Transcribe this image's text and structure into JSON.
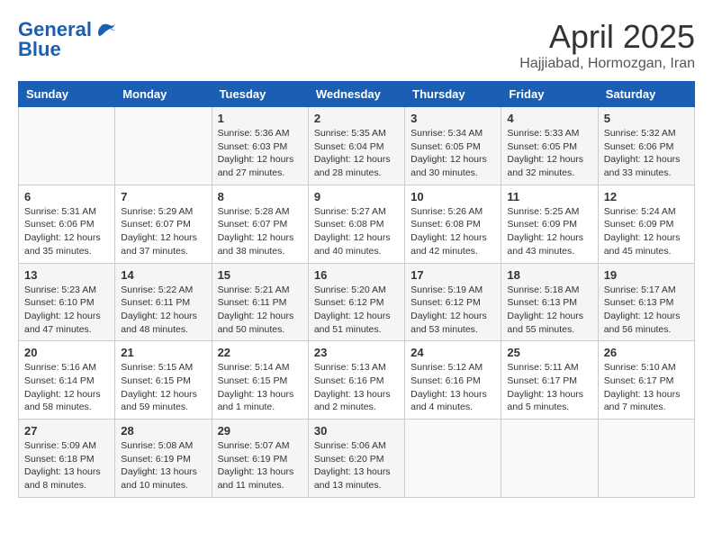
{
  "header": {
    "logo_general": "General",
    "logo_blue": "Blue",
    "title": "April 2025",
    "location": "Hajjiabad, Hormozgan, Iran"
  },
  "columns": [
    "Sunday",
    "Monday",
    "Tuesday",
    "Wednesday",
    "Thursday",
    "Friday",
    "Saturday"
  ],
  "weeks": [
    {
      "days": [
        {
          "num": "",
          "info": ""
        },
        {
          "num": "",
          "info": ""
        },
        {
          "num": "1",
          "info": "Sunrise: 5:36 AM\nSunset: 6:03 PM\nDaylight: 12 hours and 27 minutes."
        },
        {
          "num": "2",
          "info": "Sunrise: 5:35 AM\nSunset: 6:04 PM\nDaylight: 12 hours and 28 minutes."
        },
        {
          "num": "3",
          "info": "Sunrise: 5:34 AM\nSunset: 6:05 PM\nDaylight: 12 hours and 30 minutes."
        },
        {
          "num": "4",
          "info": "Sunrise: 5:33 AM\nSunset: 6:05 PM\nDaylight: 12 hours and 32 minutes."
        },
        {
          "num": "5",
          "info": "Sunrise: 5:32 AM\nSunset: 6:06 PM\nDaylight: 12 hours and 33 minutes."
        }
      ]
    },
    {
      "days": [
        {
          "num": "6",
          "info": "Sunrise: 5:31 AM\nSunset: 6:06 PM\nDaylight: 12 hours and 35 minutes."
        },
        {
          "num": "7",
          "info": "Sunrise: 5:29 AM\nSunset: 6:07 PM\nDaylight: 12 hours and 37 minutes."
        },
        {
          "num": "8",
          "info": "Sunrise: 5:28 AM\nSunset: 6:07 PM\nDaylight: 12 hours and 38 minutes."
        },
        {
          "num": "9",
          "info": "Sunrise: 5:27 AM\nSunset: 6:08 PM\nDaylight: 12 hours and 40 minutes."
        },
        {
          "num": "10",
          "info": "Sunrise: 5:26 AM\nSunset: 6:08 PM\nDaylight: 12 hours and 42 minutes."
        },
        {
          "num": "11",
          "info": "Sunrise: 5:25 AM\nSunset: 6:09 PM\nDaylight: 12 hours and 43 minutes."
        },
        {
          "num": "12",
          "info": "Sunrise: 5:24 AM\nSunset: 6:09 PM\nDaylight: 12 hours and 45 minutes."
        }
      ]
    },
    {
      "days": [
        {
          "num": "13",
          "info": "Sunrise: 5:23 AM\nSunset: 6:10 PM\nDaylight: 12 hours and 47 minutes."
        },
        {
          "num": "14",
          "info": "Sunrise: 5:22 AM\nSunset: 6:11 PM\nDaylight: 12 hours and 48 minutes."
        },
        {
          "num": "15",
          "info": "Sunrise: 5:21 AM\nSunset: 6:11 PM\nDaylight: 12 hours and 50 minutes."
        },
        {
          "num": "16",
          "info": "Sunrise: 5:20 AM\nSunset: 6:12 PM\nDaylight: 12 hours and 51 minutes."
        },
        {
          "num": "17",
          "info": "Sunrise: 5:19 AM\nSunset: 6:12 PM\nDaylight: 12 hours and 53 minutes."
        },
        {
          "num": "18",
          "info": "Sunrise: 5:18 AM\nSunset: 6:13 PM\nDaylight: 12 hours and 55 minutes."
        },
        {
          "num": "19",
          "info": "Sunrise: 5:17 AM\nSunset: 6:13 PM\nDaylight: 12 hours and 56 minutes."
        }
      ]
    },
    {
      "days": [
        {
          "num": "20",
          "info": "Sunrise: 5:16 AM\nSunset: 6:14 PM\nDaylight: 12 hours and 58 minutes."
        },
        {
          "num": "21",
          "info": "Sunrise: 5:15 AM\nSunset: 6:15 PM\nDaylight: 12 hours and 59 minutes."
        },
        {
          "num": "22",
          "info": "Sunrise: 5:14 AM\nSunset: 6:15 PM\nDaylight: 13 hours and 1 minute."
        },
        {
          "num": "23",
          "info": "Sunrise: 5:13 AM\nSunset: 6:16 PM\nDaylight: 13 hours and 2 minutes."
        },
        {
          "num": "24",
          "info": "Sunrise: 5:12 AM\nSunset: 6:16 PM\nDaylight: 13 hours and 4 minutes."
        },
        {
          "num": "25",
          "info": "Sunrise: 5:11 AM\nSunset: 6:17 PM\nDaylight: 13 hours and 5 minutes."
        },
        {
          "num": "26",
          "info": "Sunrise: 5:10 AM\nSunset: 6:17 PM\nDaylight: 13 hours and 7 minutes."
        }
      ]
    },
    {
      "days": [
        {
          "num": "27",
          "info": "Sunrise: 5:09 AM\nSunset: 6:18 PM\nDaylight: 13 hours and 8 minutes."
        },
        {
          "num": "28",
          "info": "Sunrise: 5:08 AM\nSunset: 6:19 PM\nDaylight: 13 hours and 10 minutes."
        },
        {
          "num": "29",
          "info": "Sunrise: 5:07 AM\nSunset: 6:19 PM\nDaylight: 13 hours and 11 minutes."
        },
        {
          "num": "30",
          "info": "Sunrise: 5:06 AM\nSunset: 6:20 PM\nDaylight: 13 hours and 13 minutes."
        },
        {
          "num": "",
          "info": ""
        },
        {
          "num": "",
          "info": ""
        },
        {
          "num": "",
          "info": ""
        }
      ]
    }
  ]
}
